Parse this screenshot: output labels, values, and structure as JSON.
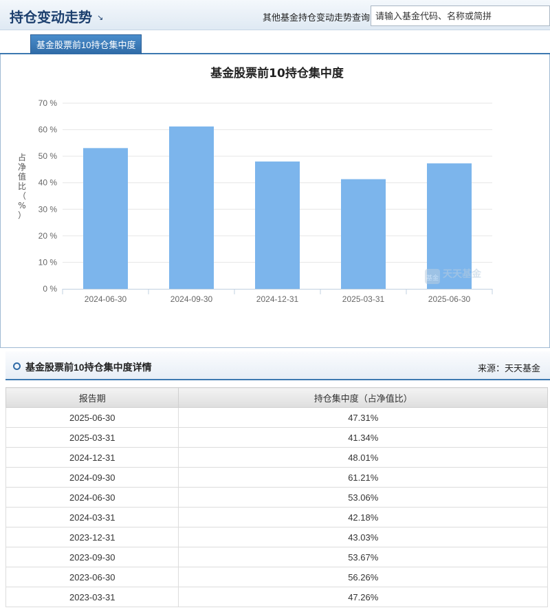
{
  "header": {
    "title": "持仓变动走势",
    "arrow": "↘",
    "search_label": "其他基金持仓变动走势查询:",
    "search_placeholder": "请输入基金代码、名称或简拼"
  },
  "tabs": [
    {
      "label": "基金股票前10持仓集中度"
    }
  ],
  "chart_data": {
    "type": "bar",
    "title": "基金股票前10持仓集中度",
    "ylabel": "占净值比（%）",
    "categories": [
      "2024-06-30",
      "2024-09-30",
      "2024-12-31",
      "2025-03-31",
      "2025-06-30"
    ],
    "values": [
      53.06,
      61.21,
      48.01,
      41.34,
      47.31
    ],
    "ylim": [
      0,
      70
    ],
    "y_ticks": [
      "0 %",
      "10 %",
      "20 %",
      "30 %",
      "40 %",
      "50 %",
      "60 %",
      "70 %"
    ],
    "bar_color": "#7cb5ec",
    "grid": true,
    "watermark": "天天基金"
  },
  "detail": {
    "title": "基金股票前10持仓集中度详情",
    "source": "来源：天天基金",
    "columns": [
      "报告期",
      "持仓集中度（占净值比）"
    ],
    "rows": [
      [
        "2025-06-30",
        "47.31%"
      ],
      [
        "2025-03-31",
        "41.34%"
      ],
      [
        "2024-12-31",
        "48.01%"
      ],
      [
        "2024-09-30",
        "61.21%"
      ],
      [
        "2024-06-30",
        "53.06%"
      ],
      [
        "2024-03-31",
        "42.18%"
      ],
      [
        "2023-12-31",
        "43.03%"
      ],
      [
        "2023-09-30",
        "53.67%"
      ],
      [
        "2023-06-30",
        "56.26%"
      ],
      [
        "2023-03-31",
        "47.26%"
      ]
    ]
  }
}
